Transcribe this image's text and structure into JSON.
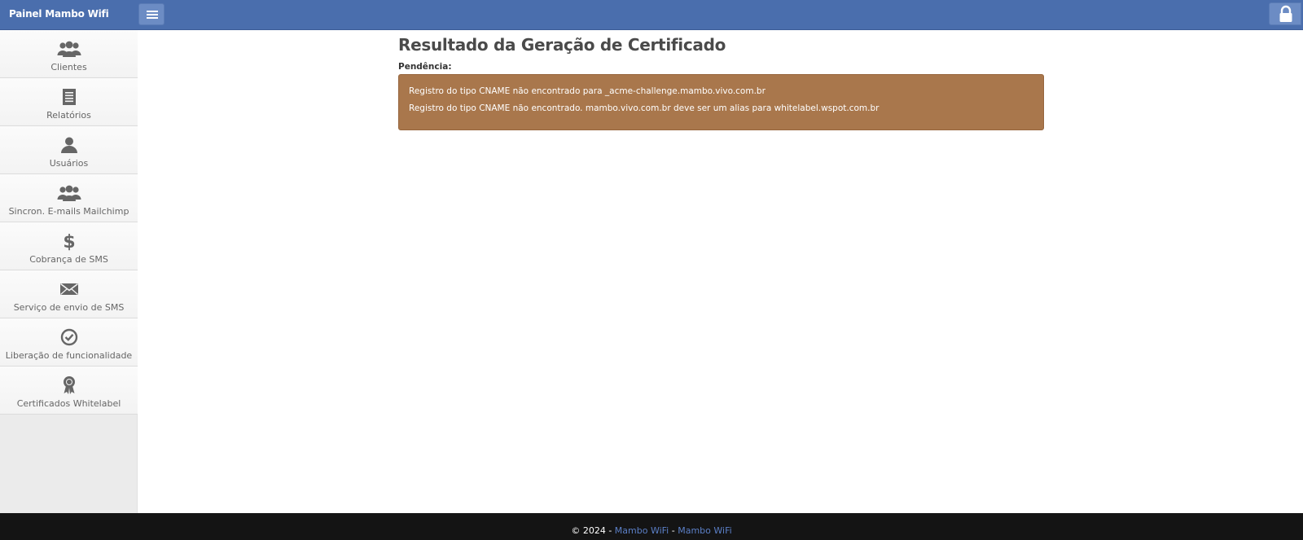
{
  "header": {
    "brand": "Painel Mambo Wifi",
    "menu_icon": "hamburger-icon",
    "lock_icon": "lock-icon"
  },
  "sidebar": {
    "items": [
      {
        "label": "Clientes",
        "icon": "users-icon"
      },
      {
        "label": "Relatórios",
        "icon": "report-icon"
      },
      {
        "label": "Usuários",
        "icon": "user-icon"
      },
      {
        "label": "Sincron. E-mails Mailchimp",
        "icon": "users-icon"
      },
      {
        "label": "Cobrança de SMS",
        "icon": "dollar-icon"
      },
      {
        "label": "Serviço de envio de SMS",
        "icon": "envelope-icon"
      },
      {
        "label": "Liberação de funcionalidade",
        "icon": "check-circle-icon"
      },
      {
        "label": "Certificados Whitelabel",
        "icon": "award-icon"
      }
    ]
  },
  "main": {
    "title": "Resultado da Geração de Certificado",
    "pending_label": "Pendência:",
    "alert_lines": [
      "Registro do tipo CNAME não encontrado para _acme-challenge.mambo.vivo.com.br",
      "Registro do tipo CNAME não encontrado. mambo.vivo.com.br deve ser um alias para whitelabel.wspot.com.br"
    ]
  },
  "footer": {
    "copyright": "© 2024 -",
    "link1": "Mambo WiFi",
    "separator": "-",
    "link2": "Mambo WiFi"
  },
  "colors": {
    "topbar": "#4a6ead",
    "alert": "#a9774c",
    "footer": "#141414",
    "footer_link": "#5b7fc6"
  }
}
